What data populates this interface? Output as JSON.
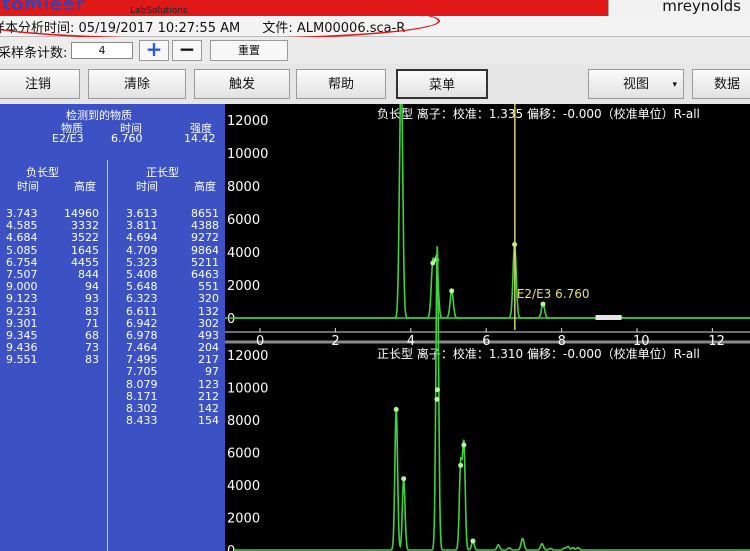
{
  "brand": {
    "logo": "tomieer",
    "subtitle": "LabSolutions"
  },
  "user": {
    "name": "mreynolds"
  },
  "info": {
    "time_label": "样本分析时间:",
    "time_value": "05/19/2017 10:27:55 AM",
    "file_label": "文件:",
    "file_value": "ALM00006.sca-R"
  },
  "count": {
    "label": "采样条计数:",
    "value": "4",
    "plus": "+",
    "minus": "−",
    "reset": "重置"
  },
  "toolbar": {
    "logout": "注销",
    "clear": "清除",
    "trigger": "触发",
    "help": "帮助",
    "menu": "菜单",
    "view": "视图",
    "view_arrow": "▾",
    "data": "数据"
  },
  "panel": {
    "title": "检测到的物质",
    "col_substance": "物质",
    "col_time": "时间",
    "col_intensity": "强度",
    "substance": "E2/E3",
    "time": "6.760",
    "intensity": "14.42",
    "neg_title": "负长型",
    "pos_title": "正长型",
    "neg_time": "时间",
    "neg_height": "高度",
    "pos_time": "时间",
    "pos_height": "高度",
    "neg_rows": [
      [
        "3.743",
        "14960"
      ],
      [
        "4.585",
        "3332"
      ],
      [
        "4.684",
        "3522"
      ],
      [
        "5.085",
        "1645"
      ],
      [
        "6.754",
        "4455"
      ],
      [
        "7.507",
        "844"
      ],
      [
        "9.000",
        "94"
      ],
      [
        "9.123",
        "93"
      ],
      [
        "9.231",
        "83"
      ],
      [
        "9.301",
        "71"
      ],
      [
        "9.345",
        "68"
      ],
      [
        "9.436",
        "73"
      ],
      [
        "9.551",
        "83"
      ]
    ],
    "pos_rows": [
      [
        "3.613",
        "8651"
      ],
      [
        "3.811",
        "4388"
      ],
      [
        "4.694",
        "9272"
      ],
      [
        "4.709",
        "9864"
      ],
      [
        "5.323",
        "5211"
      ],
      [
        "5.408",
        "6463"
      ],
      [
        "5.648",
        "551"
      ],
      [
        "6.323",
        "320"
      ],
      [
        "6.611",
        "132"
      ],
      [
        "6.942",
        "302"
      ],
      [
        "6.978",
        "493"
      ],
      [
        "7.464",
        "204"
      ],
      [
        "7.495",
        "217"
      ],
      [
        "7.705",
        "97"
      ],
      [
        "8.079",
        "123"
      ],
      [
        "8.171",
        "212"
      ],
      [
        "8.302",
        "142"
      ],
      [
        "8.433",
        "154"
      ]
    ]
  },
  "plot_top": {
    "header": "负长型 离子：校准：1.335 偏移：-0.000（校准单位）R-all",
    "y_ticks": [
      "12000",
      "10000",
      "8000",
      "6000",
      "4000",
      "2000",
      "0"
    ],
    "x_ticks": [
      "0",
      "2",
      "4",
      "6",
      "8",
      "10",
      "12"
    ],
    "marker_label": "E2/E3 6.760"
  },
  "plot_bottom": {
    "header": "正长型 离子：校准：1.310 偏移：-0.000（校准单位）R-all",
    "y_ticks": [
      "12000",
      "10000",
      "8000",
      "6000",
      "4000",
      "2000",
      "0"
    ]
  },
  "colors": {
    "trace": "#3fd23f",
    "marker": "#e8e070",
    "panel": "#3c52c4",
    "brand": "#e01818"
  }
}
